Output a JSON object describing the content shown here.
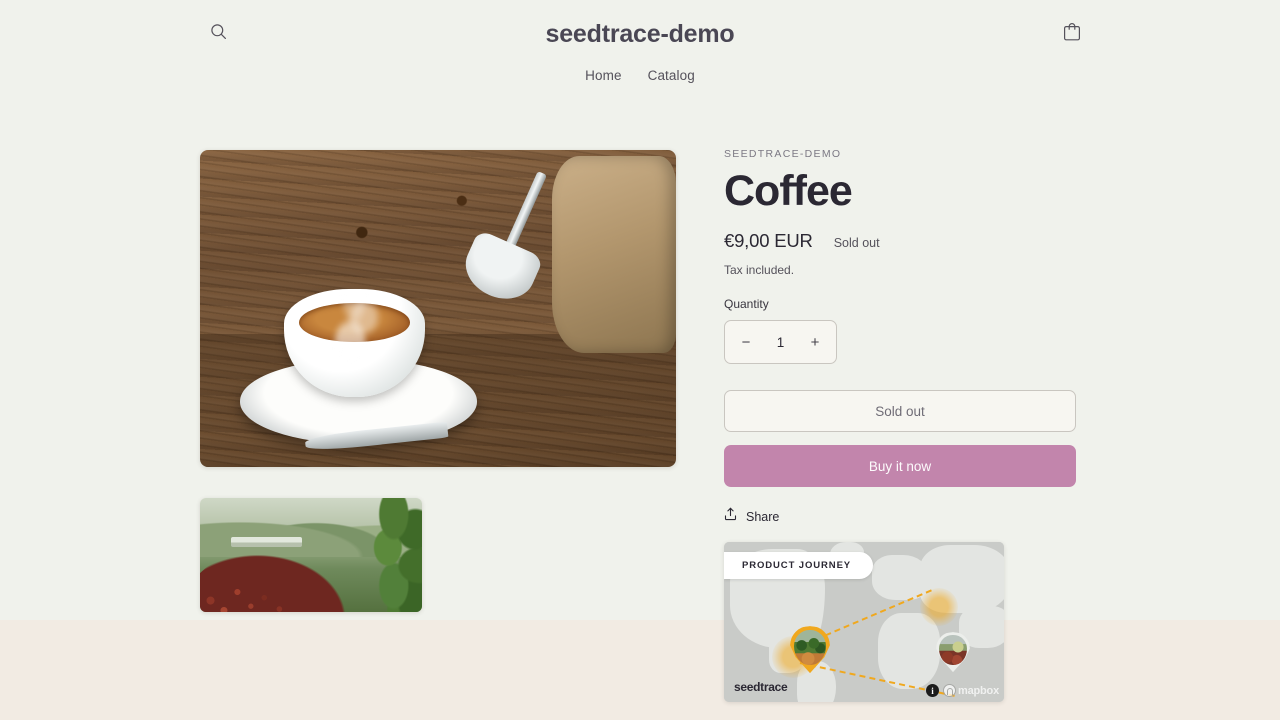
{
  "header": {
    "shop_title": "seedtrace-demo",
    "search_icon": "search-icon",
    "cart_icon": "shopping-bag-icon",
    "nav": [
      {
        "label": "Home"
      },
      {
        "label": "Catalog"
      }
    ]
  },
  "product": {
    "vendor": "SEEDTRACE-DEMO",
    "title": "Coffee",
    "price": "€9,00 EUR",
    "availability": "Sold out",
    "tax_note": "Tax included.",
    "quantity": {
      "label": "Quantity",
      "decrease": "−",
      "value": "1",
      "increase": "+"
    },
    "add_to_cart_label": "Sold out",
    "buy_now_label": "Buy it now",
    "share_label": "Share",
    "share_icon": "share-upload-icon"
  },
  "media": {
    "main_image_alt": "Espresso cup with roasted coffee beans on wooden table",
    "thumb_image_alt": "Coffee cherries drying at a farm with green hillside"
  },
  "map": {
    "badge": "PRODUCT JOURNEY",
    "brand": "seedtrace",
    "attribution_info": "i",
    "attribution_provider": "mapbox",
    "pins": [
      {
        "name": "origin-pin",
        "alt": "Coffee farm photo"
      },
      {
        "name": "destination-pin",
        "alt": "Coffee cherries photo"
      }
    ]
  },
  "colors": {
    "page_top_bg": "#f0f2ec",
    "page_bottom_bg": "#f2ebe3",
    "accent_buy": "#c285ac",
    "route_orange": "#f0a81e",
    "text_primary": "#2b2833",
    "text_muted": "#55525b"
  }
}
